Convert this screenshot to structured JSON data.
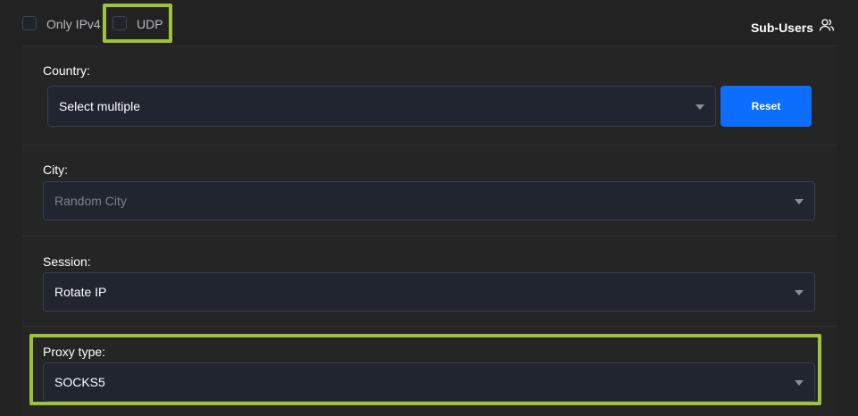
{
  "filters": {
    "only_ipv4_label": "Only IPv4",
    "udp_label": "UDP"
  },
  "header": {
    "sub_users_label": "Sub-Users",
    "sub_users_icon": "users-icon"
  },
  "country": {
    "label": "Country:",
    "value": "Select multiple",
    "reset_label": "Reset"
  },
  "city": {
    "label": "City:",
    "placeholder": "Random City"
  },
  "session": {
    "label": "Session:",
    "value": "Rotate IP"
  },
  "proxy_type": {
    "label": "Proxy type:",
    "value": "SOCKS5"
  },
  "colors": {
    "highlight": "#9dc33a",
    "accent": "#0d6efd",
    "background": "#222222"
  }
}
